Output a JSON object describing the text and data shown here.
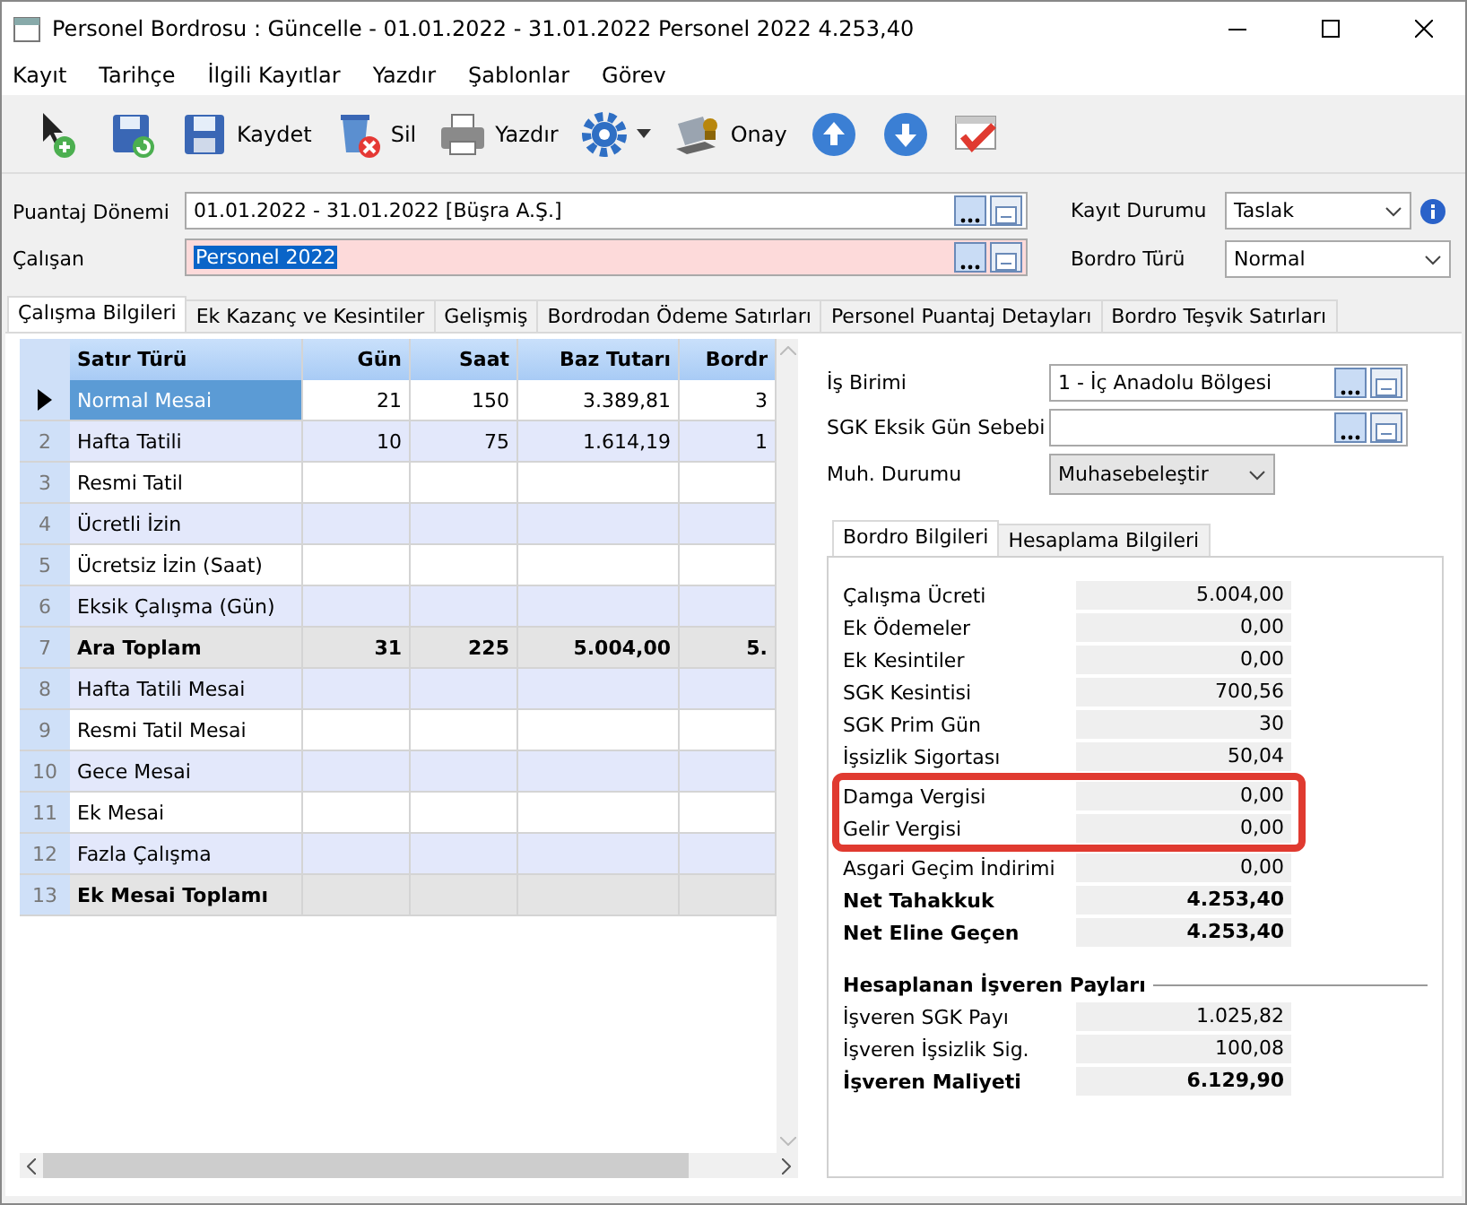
{
  "window": {
    "title": "Personel Bordrosu : Güncelle - 01.01.2022 - 31.01.2022 Personel 2022 4.253,40"
  },
  "menu": [
    "Kayıt",
    "Tarihçe",
    "İlgili Kayıtlar",
    "Yazdır",
    "Şablonlar",
    "Görev"
  ],
  "toolbar": [
    {
      "kind": "new"
    },
    {
      "kind": "save-new"
    },
    {
      "kind": "save",
      "label": "Kaydet"
    },
    {
      "kind": "delete",
      "label": "Sil"
    },
    {
      "kind": "print",
      "label": "Yazdır"
    },
    {
      "kind": "settings"
    },
    {
      "kind": "approve",
      "label": "Onay"
    },
    {
      "kind": "up"
    },
    {
      "kind": "down"
    },
    {
      "kind": "check"
    }
  ],
  "header": {
    "period": {
      "label": "Puantaj Dönemi",
      "value": "01.01.2022 - 31.01.2022 [Büşra A.Ş.]"
    },
    "employee": {
      "label": "Çalışan",
      "value": "Personel 2022"
    },
    "record_status": {
      "label": "Kayıt Durumu",
      "value": "Taslak"
    },
    "payroll_type": {
      "label": "Bordro Türü",
      "value": "Normal"
    }
  },
  "tabs": [
    {
      "label": "Çalışma Bilgileri",
      "selected": true
    },
    {
      "label": "Ek Kazanç ve Kesintiler",
      "selected": false
    },
    {
      "label": "Gelişmiş",
      "selected": false
    },
    {
      "label": "Bordrodan Ödeme Satırları",
      "selected": false
    },
    {
      "label": "Personel Puantaj Detayları",
      "selected": false
    },
    {
      "label": "Bordro Teşvik Satırları",
      "selected": false
    }
  ],
  "table": {
    "columns": [
      "Satır Türü",
      "Gün",
      "Saat",
      "Baz Tutarı",
      "Bordr"
    ],
    "rows": [
      {
        "current": true,
        "kind": "normal",
        "cells": [
          "Normal Mesai",
          "21",
          "150",
          "3.389,81",
          "3"
        ]
      },
      {
        "current": false,
        "kind": "normal",
        "number": "2",
        "cells": [
          "Hafta Tatili",
          "10",
          "75",
          "1.614,19",
          "1"
        ]
      },
      {
        "current": false,
        "kind": "normal",
        "number": "3",
        "cells": [
          "Resmi Tatil"
        ]
      },
      {
        "current": false,
        "kind": "normal",
        "number": "4",
        "cells": [
          "Ücretli İzin"
        ]
      },
      {
        "current": false,
        "kind": "normal",
        "number": "5",
        "cells": [
          "Ücretsiz İzin (Saat)"
        ]
      },
      {
        "current": false,
        "kind": "normal",
        "number": "6",
        "cells": [
          "Eksik Çalışma (Gün)"
        ]
      },
      {
        "current": false,
        "kind": "total",
        "number": "7",
        "cells": [
          "Ara Toplam",
          "31",
          "225",
          "5.004,00",
          "5."
        ]
      },
      {
        "current": false,
        "kind": "normal",
        "number": "8",
        "cells": [
          "Hafta Tatili Mesai"
        ]
      },
      {
        "current": false,
        "kind": "normal",
        "number": "9",
        "cells": [
          "Resmi Tatil Mesai"
        ]
      },
      {
        "current": false,
        "kind": "normal",
        "number": "10",
        "cells": [
          "Gece Mesai"
        ]
      },
      {
        "current": false,
        "kind": "normal",
        "number": "11",
        "cells": [
          "Ek Mesai"
        ]
      },
      {
        "current": false,
        "kind": "normal",
        "number": "12",
        "cells": [
          "Fazla Çalışma"
        ]
      },
      {
        "current": false,
        "kind": "total",
        "number": "13",
        "cells": [
          "Ek Mesai Toplamı"
        ]
      }
    ]
  },
  "details": {
    "unit": {
      "label": "İş Birimi",
      "value": "1 - İç Anadolu Bölgesi"
    },
    "sgk_reason": {
      "label": "SGK Eksik Gün Sebebi"
    },
    "accounting": {
      "label": "Muh. Durumu",
      "value": "Muhasebeleştir"
    },
    "tabs": [
      {
        "label": "Bordro Bilgileri",
        "selected": true
      },
      {
        "label": "Hesaplama Bilgileri",
        "selected": false
      }
    ],
    "summary": [
      {
        "label": "Çalışma Ücreti",
        "value": "5.004,00",
        "bold": false,
        "highlighted": false
      },
      {
        "label": "Ek Ödemeler",
        "value": "0,00",
        "bold": false,
        "highlighted": false
      },
      {
        "label": "Ek Kesintiler",
        "value": "0,00",
        "bold": false,
        "highlighted": false
      },
      {
        "label": "SGK Kesintisi",
        "value": "700,56",
        "bold": false,
        "highlighted": false
      },
      {
        "label": "SGK Prim Gün",
        "value": "30",
        "bold": false,
        "highlighted": false
      },
      {
        "label": "İşsizlik Sigortası",
        "value": "50,04",
        "bold": false,
        "highlighted": false
      },
      {
        "label": "Damga Vergisi",
        "value": "0,00",
        "bold": false,
        "highlighted": true
      },
      {
        "label": "Gelir Vergisi",
        "value": "0,00",
        "bold": false,
        "highlighted": true
      },
      {
        "label": "Asgari Geçim İndirimi",
        "value": "0,00",
        "bold": false,
        "highlighted": false
      },
      {
        "label": "Net Tahakkuk",
        "value": "4.253,40",
        "bold": true,
        "highlighted": false
      },
      {
        "label": "Net Eline Geçen",
        "value": "4.253,40",
        "bold": true,
        "highlighted": false
      }
    ],
    "employer_title": "Hesaplanan İşveren Payları",
    "employer": [
      {
        "label": "İşveren SGK Payı",
        "value": "1.025,82",
        "bold": false
      },
      {
        "label": "İşveren İşsizlik Sig.",
        "value": "100,08",
        "bold": false
      },
      {
        "label": "İşveren Maliyeti",
        "value": "6.129,90",
        "bold": true
      }
    ]
  }
}
